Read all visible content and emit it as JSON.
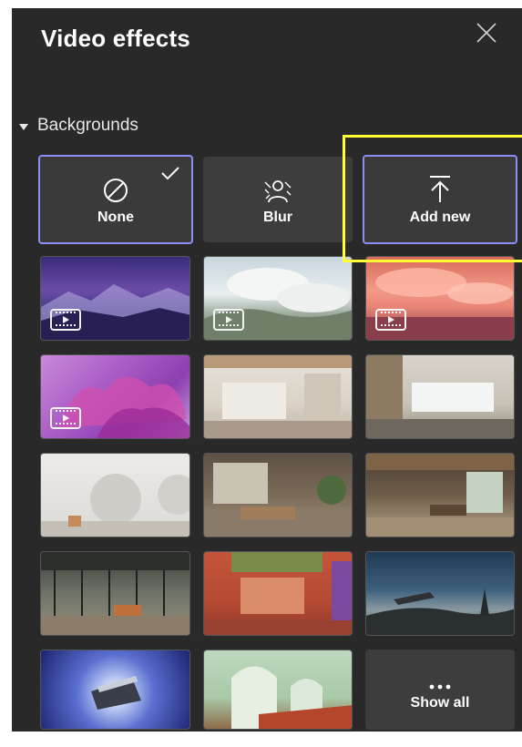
{
  "panel": {
    "title": "Video effects",
    "section_label": "Backgrounds"
  },
  "options": {
    "none_label": "None",
    "blur_label": "Blur",
    "add_label": "Add new",
    "show_all_label": "Show all"
  },
  "accent_color": "#8a8ff0",
  "highlight_color": "#ffff33",
  "icons": [
    "close-icon",
    "caret-down-icon",
    "none-icon",
    "checkmark-icon",
    "blur-icon",
    "upload-icon",
    "video-icon",
    "more-icon"
  ],
  "backgrounds": [
    {
      "name": "purple-mountains",
      "video": true
    },
    {
      "name": "cloudy-trees",
      "video": true
    },
    {
      "name": "pink-clouds",
      "video": true
    },
    {
      "name": "purple-flowers",
      "video": true
    },
    {
      "name": "white-room",
      "video": false
    },
    {
      "name": "window-loft",
      "video": false
    },
    {
      "name": "round-arches",
      "video": false
    },
    {
      "name": "plant-lounge",
      "video": false
    },
    {
      "name": "wood-dining",
      "video": false
    },
    {
      "name": "glass-pavilion",
      "video": false
    },
    {
      "name": "red-courtyard",
      "video": false
    },
    {
      "name": "night-landscape",
      "video": false
    },
    {
      "name": "space-warp",
      "video": false
    },
    {
      "name": "green-arches",
      "video": false
    }
  ]
}
